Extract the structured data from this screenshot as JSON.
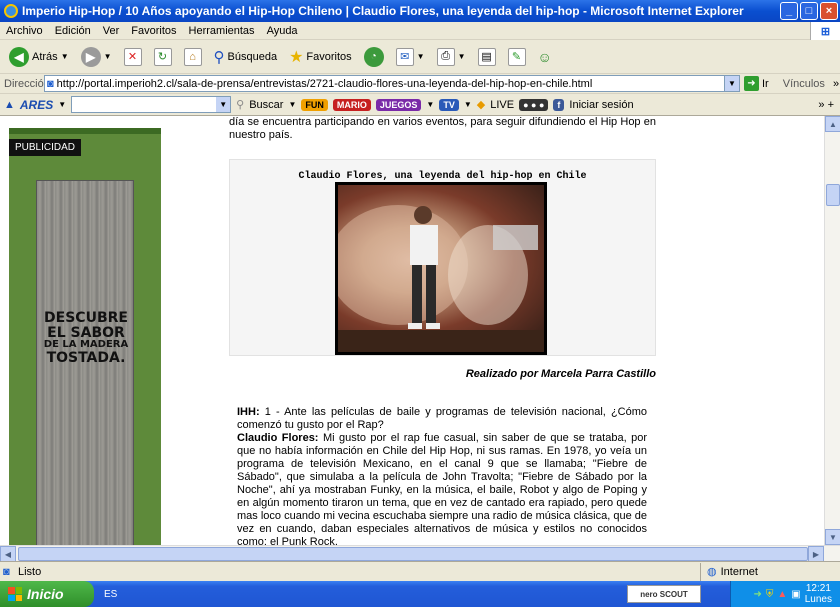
{
  "window": {
    "title": "Imperio Hip-Hop / 10 Años apoyando el Hip-Hop Chileno | Claudio Flores, una leyenda del hip-hop - Microsoft Internet Explorer",
    "minimize": "_",
    "maximize": "□",
    "close": "×"
  },
  "menu": {
    "items": [
      "Archivo",
      "Edición",
      "Ver",
      "Favoritos",
      "Herramientas",
      "Ayuda"
    ]
  },
  "toolbar": {
    "back_label": "Atrás",
    "search_label": "Búsqueda",
    "favorites_label": "Favoritos"
  },
  "address": {
    "label": "Dirección",
    "url": "http://portal.imperioh2.cl/sala-de-prensa/entrevistas/2721-claudio-flores-una-leyenda-del-hip-hop-en-chile.html",
    "go_label": "Ir",
    "links_label": "Vínculos"
  },
  "ares_bar": {
    "brand": "ARES",
    "search_value": "",
    "search_label": "Buscar",
    "fun": "FUN",
    "mario": "MARIO",
    "juegos": "JUEGOS",
    "tv": "TV",
    "live": "LIVE",
    "signin": "Iniciar sesión"
  },
  "sidebar_ad": {
    "tag": "PUBLICIDAD",
    "line1": "DESCUBRE",
    "line2": "EL SABOR",
    "line3": "DE LA MADERA",
    "line4": "TOSTADA."
  },
  "article": {
    "intro": "día se encuentra participando en varios eventos, para seguir difundiendo el Hip Hop en nuestro país.",
    "figure_caption": "Claudio Flores, una leyenda del hip-hop en Chile",
    "byline": "Realizado por Marcela Parra Castillo",
    "q1_label": "IHH:",
    "q1_text": " 1 - Ante las películas de baile y programas de televisión nacional, ¿Cómo comenzó tu gusto por el Rap?",
    "a1_label": "Claudio Flores:",
    "a1_text": " Mi gusto por el rap fue casual, sin saber de que se trataba, por que no había información en Chile del Hip Hop, ni sus ramas. En 1978, yo veía un programa de televisión Mexicano, en el canal 9 que se llamaba; \"Fiebre de Sábado\", que simulaba a la película de John Travolta; \"Fiebre de Sábado por la Noche\", ahí ya mostraban Funky, en la música, el baile, Robot y algo de Poping y en algún momento tiraron un tema, que en vez de cantado era rapiado, pero quede mas loco cuando mi vecina escuchaba siempre una radio de música clásica, que de vez en cuando, daban especiales alternativos de música y estilos no conocidos como; el Punk Rock."
  },
  "status": {
    "text": "Listo",
    "zone": "Internet"
  },
  "taskbar": {
    "start": "Inicio",
    "lang": "ES",
    "nero": "nero SCOUT",
    "time": "12:21",
    "day": "Lunes"
  }
}
